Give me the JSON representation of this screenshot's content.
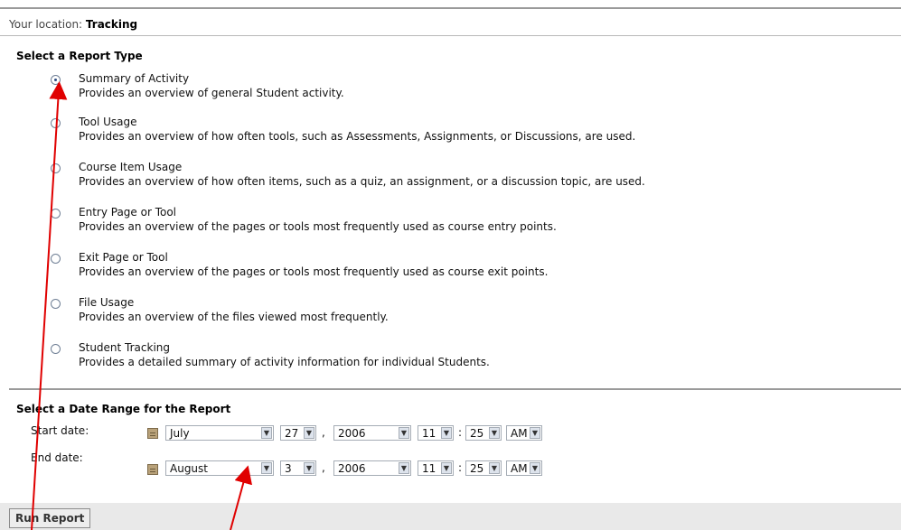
{
  "breadcrumb": {
    "prefix": "Your location:",
    "current": "Tracking"
  },
  "report_type": {
    "title": "Select a Report Type",
    "options": [
      {
        "label": "Summary of Activity",
        "description": "Provides an overview of general Student activity.",
        "selected": true
      },
      {
        "label": "Tool Usage",
        "description": "Provides an overview of how often tools, such as Assessments, Assignments, or Discussions, are used.",
        "selected": false
      },
      {
        "label": "Course Item Usage",
        "description": "Provides an overview of how often items, such as a quiz, an assignment, or a discussion topic, are used.",
        "selected": false
      },
      {
        "label": "Entry Page or Tool",
        "description": "Provides an overview of the pages or tools most frequently used as course entry points.",
        "selected": false
      },
      {
        "label": "Exit Page or Tool",
        "description": "Provides an overview of the pages or tools most frequently used as course exit points.",
        "selected": false
      },
      {
        "label": "File Usage",
        "description": "Provides an overview of the files viewed most frequently.",
        "selected": false
      },
      {
        "label": "Student Tracking",
        "description": "Provides a detailed summary of activity information for individual Students.",
        "selected": false
      }
    ]
  },
  "date_range": {
    "title": "Select a Date Range for the Report",
    "start": {
      "label": "Start date:",
      "month": "July",
      "day": "27",
      "year": "2006",
      "hour": "11",
      "minute": "25",
      "ampm": "AM"
    },
    "end": {
      "label": "End date:",
      "month": "August",
      "day": "3",
      "year": "2006",
      "hour": "11",
      "minute": "25",
      "ampm": "AM"
    },
    "comma": ",",
    "colon": ":"
  },
  "footer": {
    "run_label": "Run Report"
  },
  "icons": {
    "calendar": "calendar-icon",
    "dropdown": "chevron-down-icon",
    "radio": "radio-icon"
  },
  "colors": {
    "arrow": "#e00000",
    "rule": "#9a9a9a",
    "footer_bg": "#e9e9e9"
  }
}
